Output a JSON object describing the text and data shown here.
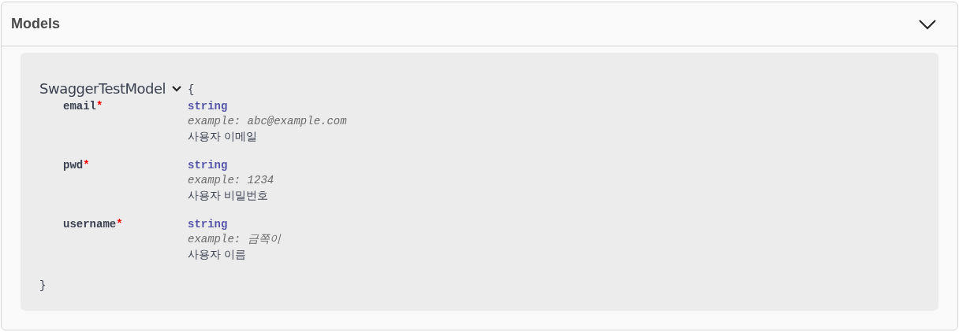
{
  "section": {
    "title": "Models",
    "expanded": true
  },
  "model": {
    "name": "SwaggerTestModel",
    "expanded": true,
    "open_brace": "{",
    "close_brace": "}",
    "required_mark": "*",
    "properties": [
      {
        "name": "email",
        "required": true,
        "type": "string",
        "example": "example: abc@example.com",
        "description": "사용자 이메일"
      },
      {
        "name": "pwd",
        "required": true,
        "type": "string",
        "example": "example: 1234",
        "description": "사용자 비밀번호"
      },
      {
        "name": "username",
        "required": true,
        "type": "string",
        "example": "example: 금쪽이",
        "description": "사용자 이름"
      }
    ]
  }
}
